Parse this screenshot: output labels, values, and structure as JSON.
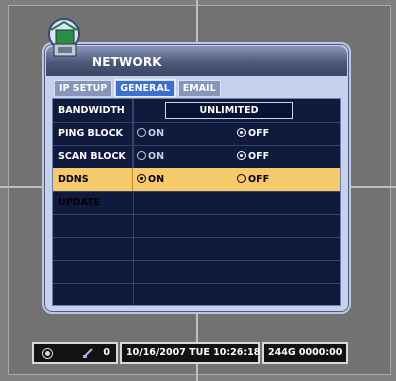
{
  "window": {
    "title": "NETWORK",
    "tabs": [
      {
        "label": "IP SETUP"
      },
      {
        "label": "GENERAL"
      },
      {
        "label": "EMAIL"
      }
    ]
  },
  "settings": {
    "bandwidth": {
      "label": "BANDWIDTH",
      "value": "UNLIMITED"
    },
    "ping_block": {
      "label": "PING BLOCK",
      "on": "ON",
      "off": "OFF",
      "selected": "OFF"
    },
    "scan_block": {
      "label": "SCAN BLOCK",
      "on": "ON",
      "off": "OFF",
      "selected": "OFF"
    },
    "ddns_update": {
      "label": "DDNS UPDATE",
      "on": "ON",
      "off": "OFF",
      "selected": "ON"
    }
  },
  "status_bar": {
    "count": "0",
    "datetime": "10/16/2007 TUE 10:26:18",
    "disk": "244G  0000:00"
  },
  "colors": {
    "highlight": "#f6c96a",
    "active_tab": "#3b6fd2",
    "table_bg": "#0f1a3c"
  }
}
